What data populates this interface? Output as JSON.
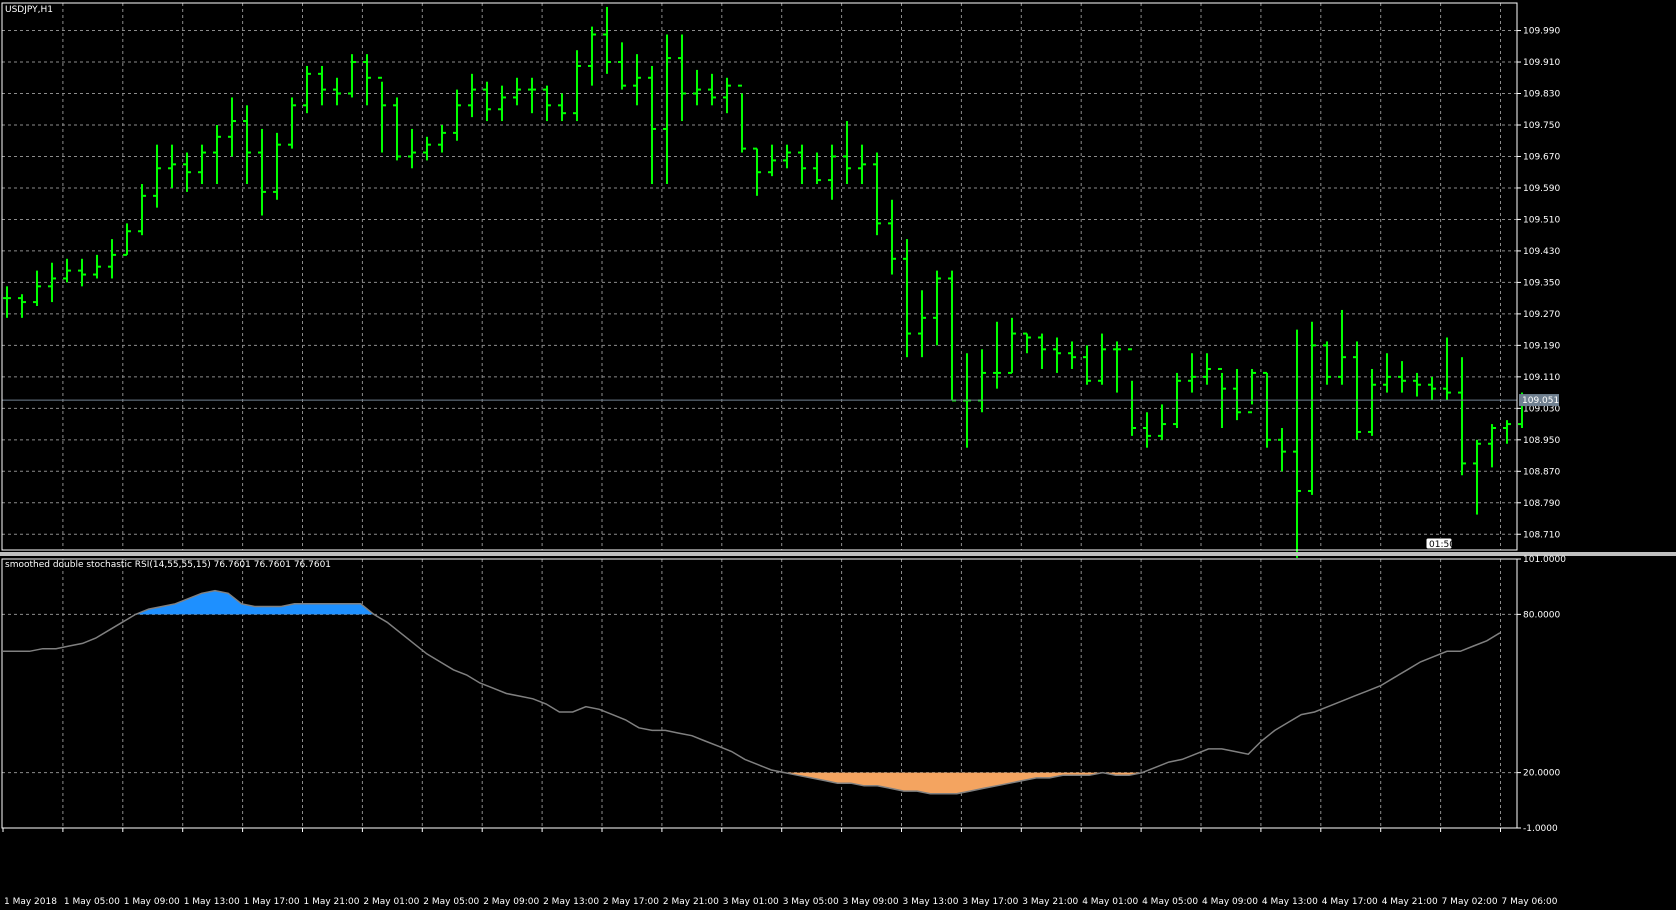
{
  "window": {
    "symbol_label": "USDJPY,H1",
    "indicator_label": "smoothed double stochastic RSI(14,55,55,15) 76.7601 76.7601 76.7601"
  },
  "colors": {
    "background": "#000000",
    "grid": "#8c8c8c",
    "bars": "#00ff00",
    "indicator_line": "#808080",
    "overbought_fill": "#1e90ff",
    "oversold_fill": "#f4a460",
    "price_line": "#708090",
    "separator": "#c0c0c0"
  },
  "price_axis": {
    "ticks": [
      "109.990",
      "109.910",
      "109.830",
      "109.750",
      "109.670",
      "109.590",
      "109.510",
      "109.430",
      "109.350",
      "109.270",
      "109.190",
      "109.110",
      "109.030",
      "108.950",
      "108.870",
      "108.790",
      "108.710"
    ],
    "current_price": "109.051",
    "min": 108.67,
    "max": 110.06
  },
  "indicator_axis": {
    "ticks": [
      "101.0000",
      "80.0000",
      "20.0000",
      "-1.0000"
    ],
    "min": -1,
    "max": 101,
    "overbought": 80,
    "oversold": 20
  },
  "time_axis": {
    "ticks": [
      "1 May 2018",
      "1 May 05:00",
      "1 May 09:00",
      "1 May 13:00",
      "1 May 17:00",
      "1 May 21:00",
      "2 May 01:00",
      "2 May 05:00",
      "2 May 09:00",
      "2 May 13:00",
      "2 May 17:00",
      "2 May 21:00",
      "3 May 01:00",
      "3 May 05:00",
      "3 May 09:00",
      "3 May 13:00",
      "3 May 17:00",
      "3 May 21:00",
      "4 May 01:00",
      "4 May 05:00",
      "4 May 09:00",
      "4 May 13:00",
      "4 May 17:00",
      "4 May 21:00",
      "7 May 02:00",
      "7 May 06:00"
    ]
  },
  "countdown": "01:50",
  "chart_data": [
    {
      "type": "ohlc",
      "title": "USDJPY,H1",
      "bars_close": [
        109.31,
        109.3,
        109.34,
        109.36,
        109.38,
        109.37,
        109.39,
        109.42,
        109.48,
        109.57,
        109.64,
        109.65,
        109.63,
        109.68,
        109.72,
        109.76,
        109.68,
        109.58,
        109.7,
        109.8,
        109.88,
        109.84,
        109.83,
        109.91,
        109.87,
        109.8,
        109.67,
        109.68,
        109.7,
        109.73,
        109.8,
        109.84,
        109.79,
        109.82,
        109.84,
        109.84,
        109.8,
        109.78,
        109.9,
        109.98,
        109.91,
        109.85,
        109.87,
        109.74,
        109.92,
        109.83,
        109.84,
        109.82,
        109.85,
        109.69,
        109.63,
        109.66,
        109.68,
        109.64,
        109.61,
        109.67,
        109.64,
        109.65,
        109.5,
        109.41,
        109.22,
        109.26,
        109.36,
        109.05,
        109.05,
        109.12,
        109.12,
        109.22,
        109.21,
        109.18,
        109.17,
        109.16,
        109.1,
        109.18,
        109.18,
        108.98,
        108.96,
        108.99,
        109.1,
        109.11,
        109.13,
        109.08,
        109.02,
        109.12,
        108.95,
        108.92,
        108.82,
        109.19,
        109.11,
        109.16,
        108.97,
        109.09,
        109.11,
        109.1,
        109.09,
        109.08,
        109.07,
        108.89,
        108.94,
        108.98,
        108.99,
        109.06
      ],
      "bars_high": [
        109.34,
        109.32,
        109.38,
        109.4,
        109.41,
        109.41,
        109.42,
        109.46,
        109.5,
        109.6,
        109.7,
        109.7,
        109.68,
        109.7,
        109.75,
        109.82,
        109.8,
        109.74,
        109.73,
        109.82,
        109.9,
        109.9,
        109.87,
        109.93,
        109.93,
        109.86,
        109.82,
        109.74,
        109.72,
        109.75,
        109.84,
        109.88,
        109.86,
        109.85,
        109.87,
        109.87,
        109.85,
        109.83,
        109.94,
        110.0,
        110.05,
        109.96,
        109.93,
        109.9,
        109.98,
        109.98,
        109.89,
        109.88,
        109.87,
        109.83,
        109.69,
        109.7,
        109.7,
        109.7,
        109.68,
        109.7,
        109.76,
        109.7,
        109.68,
        109.56,
        109.46,
        109.33,
        109.38,
        109.38,
        109.17,
        109.18,
        109.25,
        109.26,
        109.22,
        109.22,
        109.21,
        109.2,
        109.19,
        109.22,
        109.2,
        109.1,
        109.02,
        109.04,
        109.12,
        109.17,
        109.17,
        109.12,
        109.13,
        109.13,
        109.12,
        108.98,
        109.23,
        109.25,
        109.2,
        109.28,
        109.2,
        109.13,
        109.17,
        109.15,
        109.12,
        109.11,
        109.21,
        109.16,
        108.95,
        108.99,
        109.0,
        109.07
      ],
      "bars_low": [
        109.26,
        109.26,
        109.29,
        109.3,
        109.35,
        109.34,
        109.36,
        109.36,
        109.42,
        109.47,
        109.54,
        109.59,
        109.58,
        109.6,
        109.6,
        109.67,
        109.6,
        109.52,
        109.56,
        109.69,
        109.78,
        109.8,
        109.8,
        109.82,
        109.8,
        109.68,
        109.66,
        109.64,
        109.66,
        109.68,
        109.71,
        109.77,
        109.76,
        109.76,
        109.8,
        109.78,
        109.76,
        109.76,
        109.76,
        109.85,
        109.88,
        109.84,
        109.8,
        109.6,
        109.6,
        109.76,
        109.8,
        109.8,
        109.78,
        109.68,
        109.57,
        109.62,
        109.64,
        109.6,
        109.6,
        109.56,
        109.6,
        109.6,
        109.47,
        109.37,
        109.16,
        109.16,
        109.19,
        109.05,
        108.93,
        109.02,
        109.08,
        109.12,
        109.17,
        109.13,
        109.12,
        109.13,
        109.09,
        109.09,
        109.07,
        108.96,
        108.93,
        108.95,
        108.98,
        109.07,
        109.09,
        108.98,
        109.0,
        109.04,
        108.93,
        108.87,
        108.65,
        108.81,
        109.09,
        109.09,
        108.95,
        108.96,
        109.07,
        109.07,
        109.06,
        109.05,
        109.05,
        108.86,
        108.76,
        108.88,
        108.94,
        108.98
      ]
    },
    {
      "type": "line",
      "title": "smoothed double stochastic RSI(14,55,55,15) 76.7601 76.7601 76.7601",
      "ylim": [
        -1,
        101
      ],
      "values": [
        66,
        66,
        66,
        67,
        67,
        68,
        69,
        71,
        74,
        77,
        80,
        82,
        83,
        84,
        86,
        88,
        89,
        88,
        84,
        83,
        83,
        83,
        84,
        84,
        84,
        84,
        84,
        84,
        80,
        77,
        73,
        69,
        65,
        62,
        59,
        57,
        54,
        52,
        50,
        49,
        48,
        46,
        43,
        43,
        45,
        44,
        42,
        40,
        37,
        36,
        36,
        35,
        34,
        32,
        30,
        28,
        25,
        23,
        21,
        20,
        19,
        18,
        17,
        16,
        16,
        15,
        15,
        14,
        13,
        13,
        12,
        12,
        12,
        13,
        14,
        15,
        16,
        17,
        18,
        18,
        19,
        19,
        19,
        20,
        19,
        19,
        20,
        22,
        24,
        25,
        27,
        29,
        29,
        28,
        27,
        32,
        36,
        39,
        42,
        43,
        45,
        47,
        49,
        51,
        53,
        56,
        59,
        62,
        64,
        66,
        66,
        68,
        70,
        73
      ]
    }
  ]
}
